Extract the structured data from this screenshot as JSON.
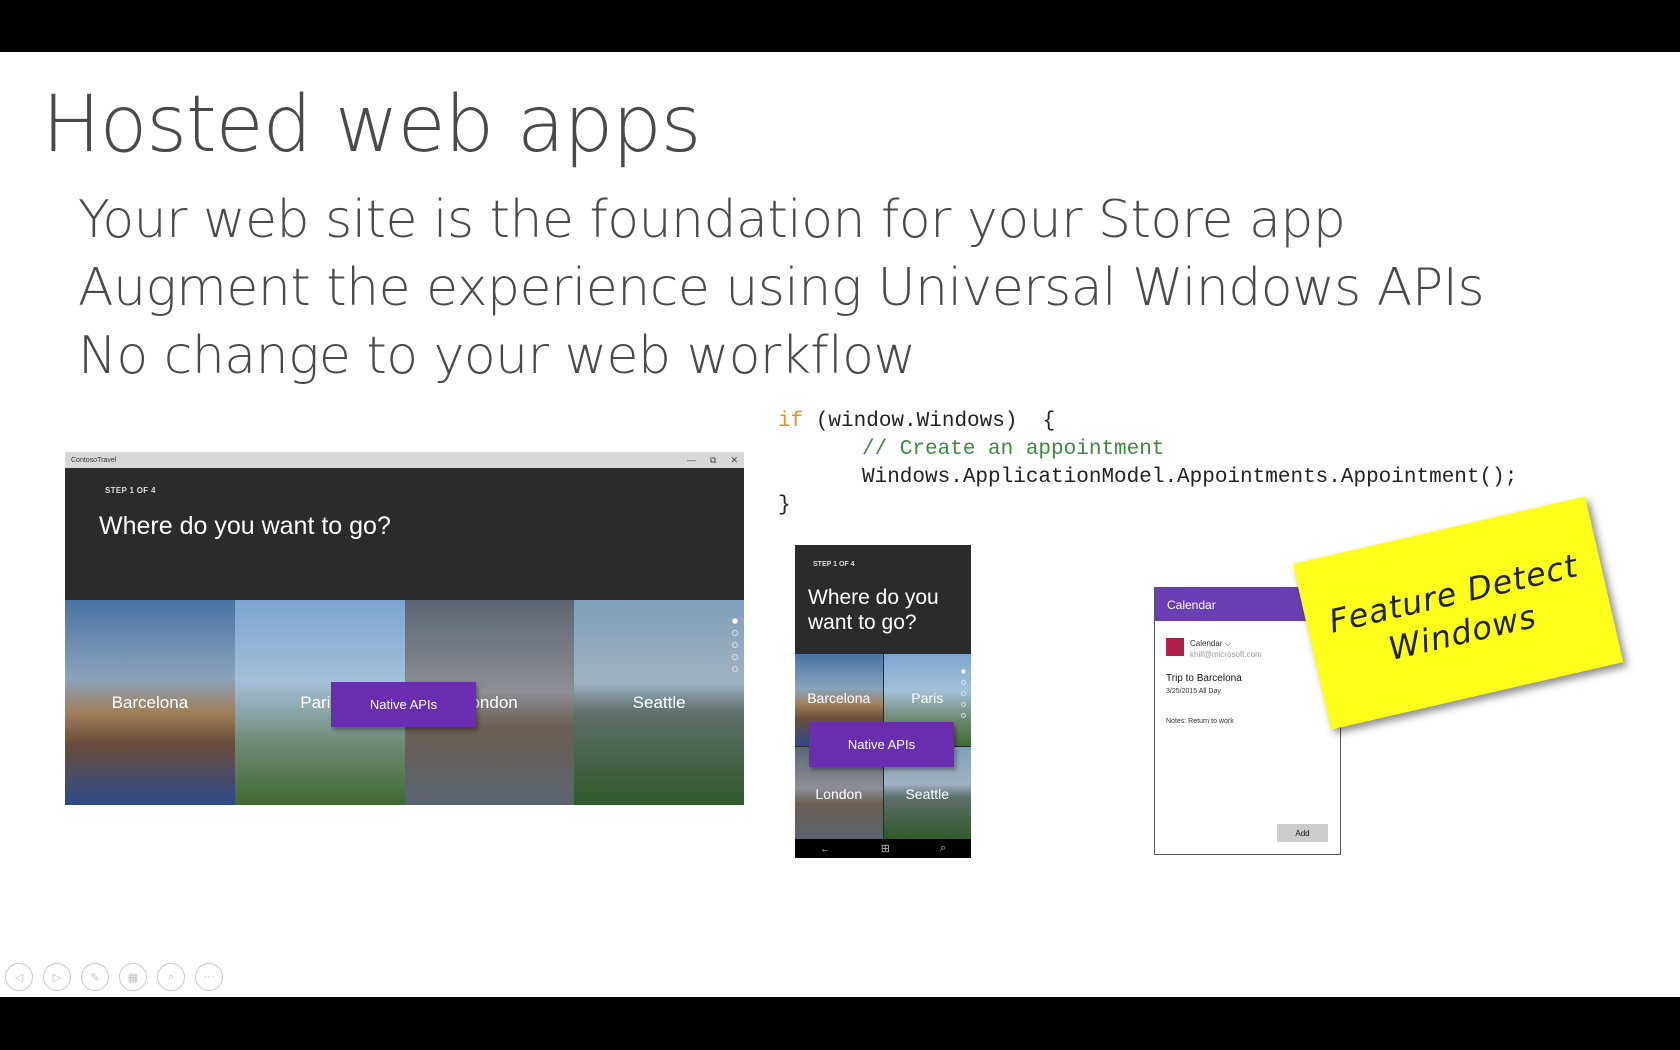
{
  "slide": {
    "title": "Hosted web apps",
    "bullets": [
      "Your web site is the foundation for your Store app",
      "Augment the experience using Universal Windows APIs",
      "No change to your web workflow"
    ]
  },
  "code": {
    "line1_keyword": "if",
    "line1_rest": " (window.Windows)  {",
    "line2_comment": "// Create an appointment",
    "line3": "Windows.ApplicationModel.Appointments.Appointment();",
    "line4": "}"
  },
  "desktop_app": {
    "window_title": "ContosoTravel",
    "controls": {
      "minimize": "—",
      "restore": "⧉",
      "close": "✕"
    },
    "step": "STEP 1 OF 4",
    "heading": "Where do you want to go?",
    "cities": [
      "Barcelona",
      "Paris",
      "London",
      "Seattle"
    ],
    "native_button": "Native APIs"
  },
  "phone_app": {
    "step": "STEP 1 OF 4",
    "heading_line1": "Where do you",
    "heading_line2": "want to go?",
    "cities": [
      "Barcelona",
      "Paris",
      "London",
      "Seattle"
    ],
    "native_button": "Native APIs",
    "nav": {
      "back": "←",
      "home": "⊞",
      "search": "⌕"
    }
  },
  "calendar": {
    "header": "Calendar",
    "account_name": "Calendar ⌵",
    "account_email": "khill@microsoft.com",
    "event_title": "Trip to Barcelona",
    "event_date": "3/25/2015 All Day",
    "notes": "Notes: Return to work",
    "add_button": "Add"
  },
  "sticky_note": {
    "line1": "Feature Detect",
    "line2": "Windows"
  },
  "presenter_tools": {
    "prev": "◁",
    "next": "▷",
    "pen": "✎",
    "slides": "▦",
    "zoom": "⌕",
    "more": "···"
  },
  "colors": {
    "accent_purple": "#6a2db0",
    "keyword_orange": "#e6960f",
    "comment_green": "#3c8a3c",
    "sticky_yellow": "#ffff1c"
  }
}
